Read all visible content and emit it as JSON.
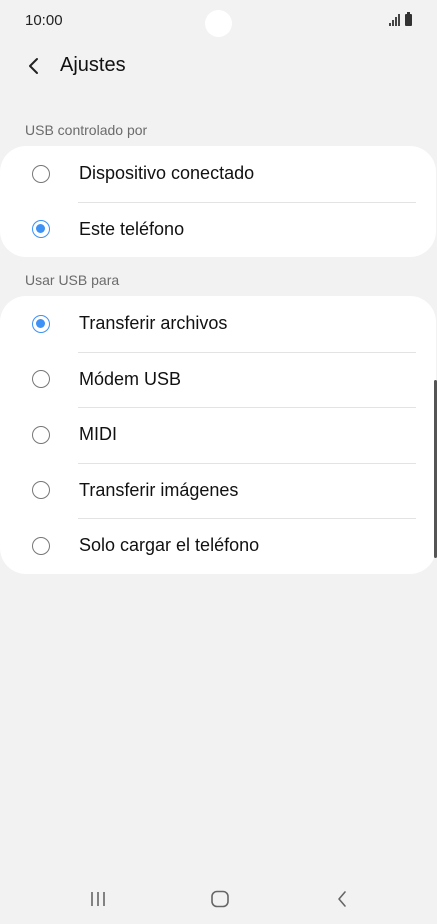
{
  "status_bar": {
    "time": "10:00"
  },
  "header": {
    "back_icon": "chevron-left-icon",
    "title": "Ajustes"
  },
  "usb_controlled_by": {
    "label": "USB controlado por",
    "options": [
      {
        "label": "Dispositivo conectado",
        "selected": false
      },
      {
        "label": "Este teléfono",
        "selected": true
      }
    ]
  },
  "use_usb_for": {
    "label": "Usar USB para",
    "options": [
      {
        "label": "Transferir archivos",
        "selected": true
      },
      {
        "label": "Módem USB",
        "selected": false
      },
      {
        "label": "MIDI",
        "selected": false
      },
      {
        "label": "Transferir imágenes",
        "selected": false
      },
      {
        "label": "Solo cargar el teléfono",
        "selected": false
      }
    ]
  },
  "nav_bar": {
    "recents_icon": "recents-icon",
    "home_icon": "home-icon",
    "back_icon": "back-icon"
  },
  "colors": {
    "accent": "#3e91f5",
    "background": "#f2f2f2",
    "card": "#ffffff"
  }
}
